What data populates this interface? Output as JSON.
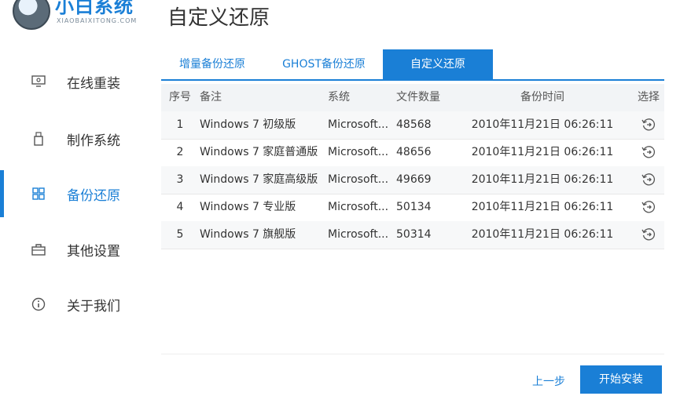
{
  "app": {
    "logo_title": "小白系统",
    "logo_subtitle": "XIAOBAIXITONG.COM",
    "page_title": "自定义还原"
  },
  "sidebar": {
    "items": [
      {
        "label": "在线重装",
        "icon": "monitor-icon"
      },
      {
        "label": "制作系统",
        "icon": "usb-icon"
      },
      {
        "label": "备份还原",
        "icon": "grid-icon"
      },
      {
        "label": "其他设置",
        "icon": "briefcase-icon"
      },
      {
        "label": "关于我们",
        "icon": "info-icon"
      }
    ],
    "active_index": 2
  },
  "tabs": [
    {
      "label": "增量备份还原"
    },
    {
      "label": "GHOST备份还原"
    },
    {
      "label": "自定义还原"
    }
  ],
  "table": {
    "headers": [
      "序号",
      "备注",
      "系统",
      "文件数量",
      "备份时间",
      "选择"
    ],
    "rows": [
      {
        "no": "1",
        "note": "Windows 7 初级版",
        "system": "Microsoft...",
        "count": "48568",
        "time": "2010年11月21日 06:26:11"
      },
      {
        "no": "2",
        "note": "Windows 7 家庭普通版",
        "system": "Microsoft...",
        "count": "48656",
        "time": "2010年11月21日 06:26:11"
      },
      {
        "no": "3",
        "note": "Windows 7 家庭高级版",
        "system": "Microsoft...",
        "count": "49669",
        "time": "2010年11月21日 06:26:11"
      },
      {
        "no": "4",
        "note": "Windows 7 专业版",
        "system": "Microsoft...",
        "count": "50134",
        "time": "2010年11月21日 06:26:11"
      },
      {
        "no": "5",
        "note": "Windows 7 旗舰版",
        "system": "Microsoft...",
        "count": "50314",
        "time": "2010年11月21日 06:26:11"
      }
    ]
  },
  "footer": {
    "prev_label": "上一步",
    "start_label": "开始安装"
  },
  "colors": {
    "accent": "#1a7fd6"
  }
}
